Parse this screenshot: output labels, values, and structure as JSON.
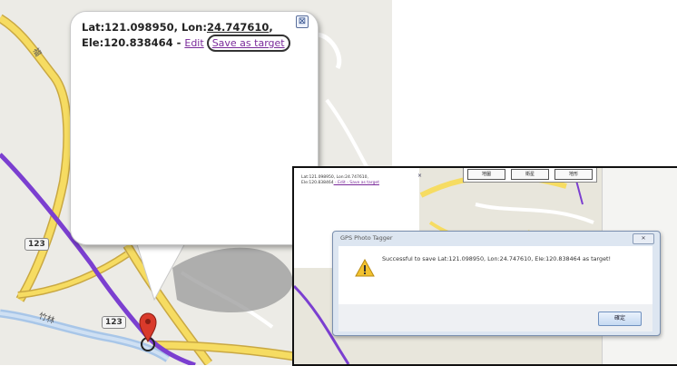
{
  "main_map": {
    "infowindow": {
      "lat_text": "Lat:121.098950, Lon:",
      "lon_value": "24.747610",
      "lon_comma": ",",
      "ele_text": "Ele:120.838464",
      "edit_sep": " - ",
      "edit_link": "Edit",
      "save_target_link": "Save as target",
      "close_symbol": "⊠"
    },
    "road_shields": [
      "123",
      "123"
    ],
    "marker_icon": "map-pin-icon"
  },
  "inset": {
    "infowindow": {
      "line1": "Lat:121.098950, Lon:24.747610,",
      "line2": "Ele:120.838464",
      "links": " - Edit - Save as target",
      "close_symbol": "×"
    },
    "toolbar_buttons": [
      "地圖",
      "衛星",
      "地形"
    ],
    "dialog": {
      "title": "GPS Photo Tagger",
      "close_symbol": "✕",
      "message": "Successful to save Lat:121.098950, Lon:24.747610, Ele:120.838464 as target!",
      "ok_button": "確定",
      "icon": "warning-icon"
    }
  },
  "colors": {
    "route": "#7b3fd0",
    "road": "#f6dc62",
    "map_bg": "#ecebe6",
    "marker": "#d93a2b"
  }
}
